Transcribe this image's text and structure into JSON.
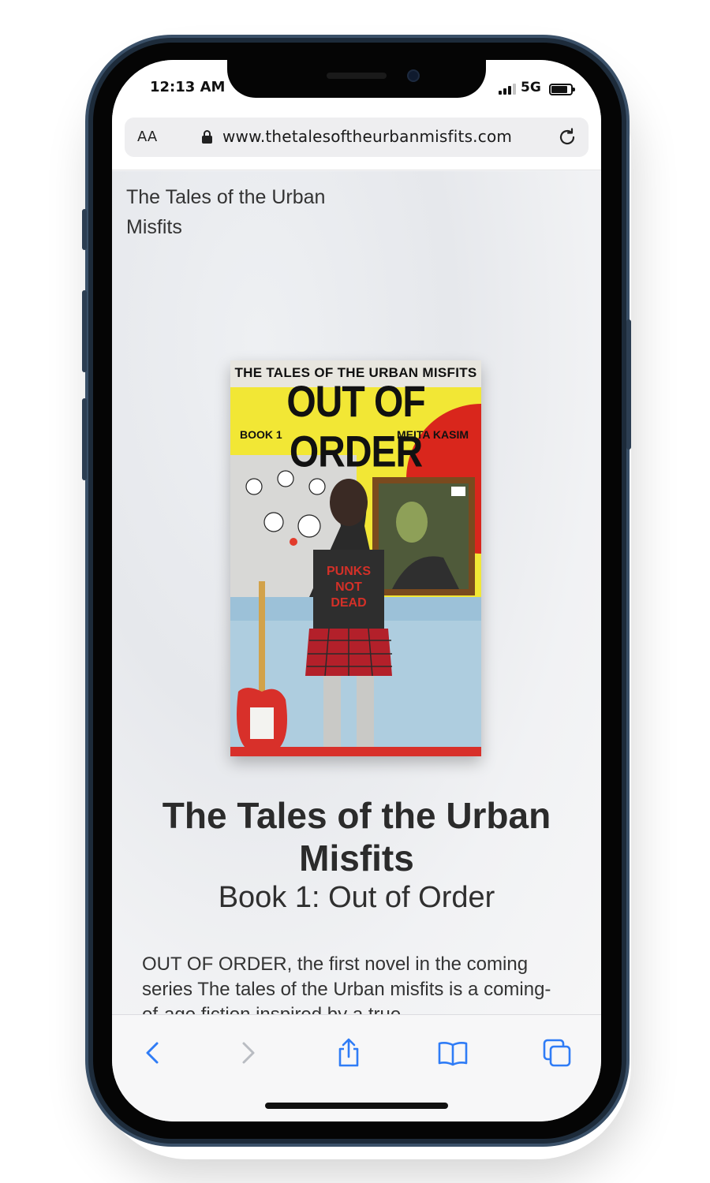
{
  "status": {
    "time": "12:13 AM",
    "network": "5G"
  },
  "browser": {
    "text_size_label": "AA",
    "url": "www.thetalesoftheurbanmisfits.com"
  },
  "site": {
    "title": "The Tales of the Urban Misfits"
  },
  "cover": {
    "series": "THE TALES OF THE URBAN MISFITS",
    "title": "OUT OF ORDER",
    "book": "BOOK 1",
    "author": "MEITA KASIM"
  },
  "book": {
    "heading": "The Tales of the Urban Misfits",
    "subtitle": "Book 1: Out of Order",
    "description": "OUT OF ORDER, the first novel in the coming series The tales of the Urban misfits is a coming-of-age fiction inspired by a true"
  },
  "toolbar": {
    "icons": [
      "back-icon",
      "forward-icon",
      "share-icon",
      "bookmarks-icon",
      "tabs-icon"
    ]
  },
  "colors": {
    "accent": "#2f7cf6",
    "disabled": "#b9bcc2",
    "frame": "#1d2b3a"
  }
}
